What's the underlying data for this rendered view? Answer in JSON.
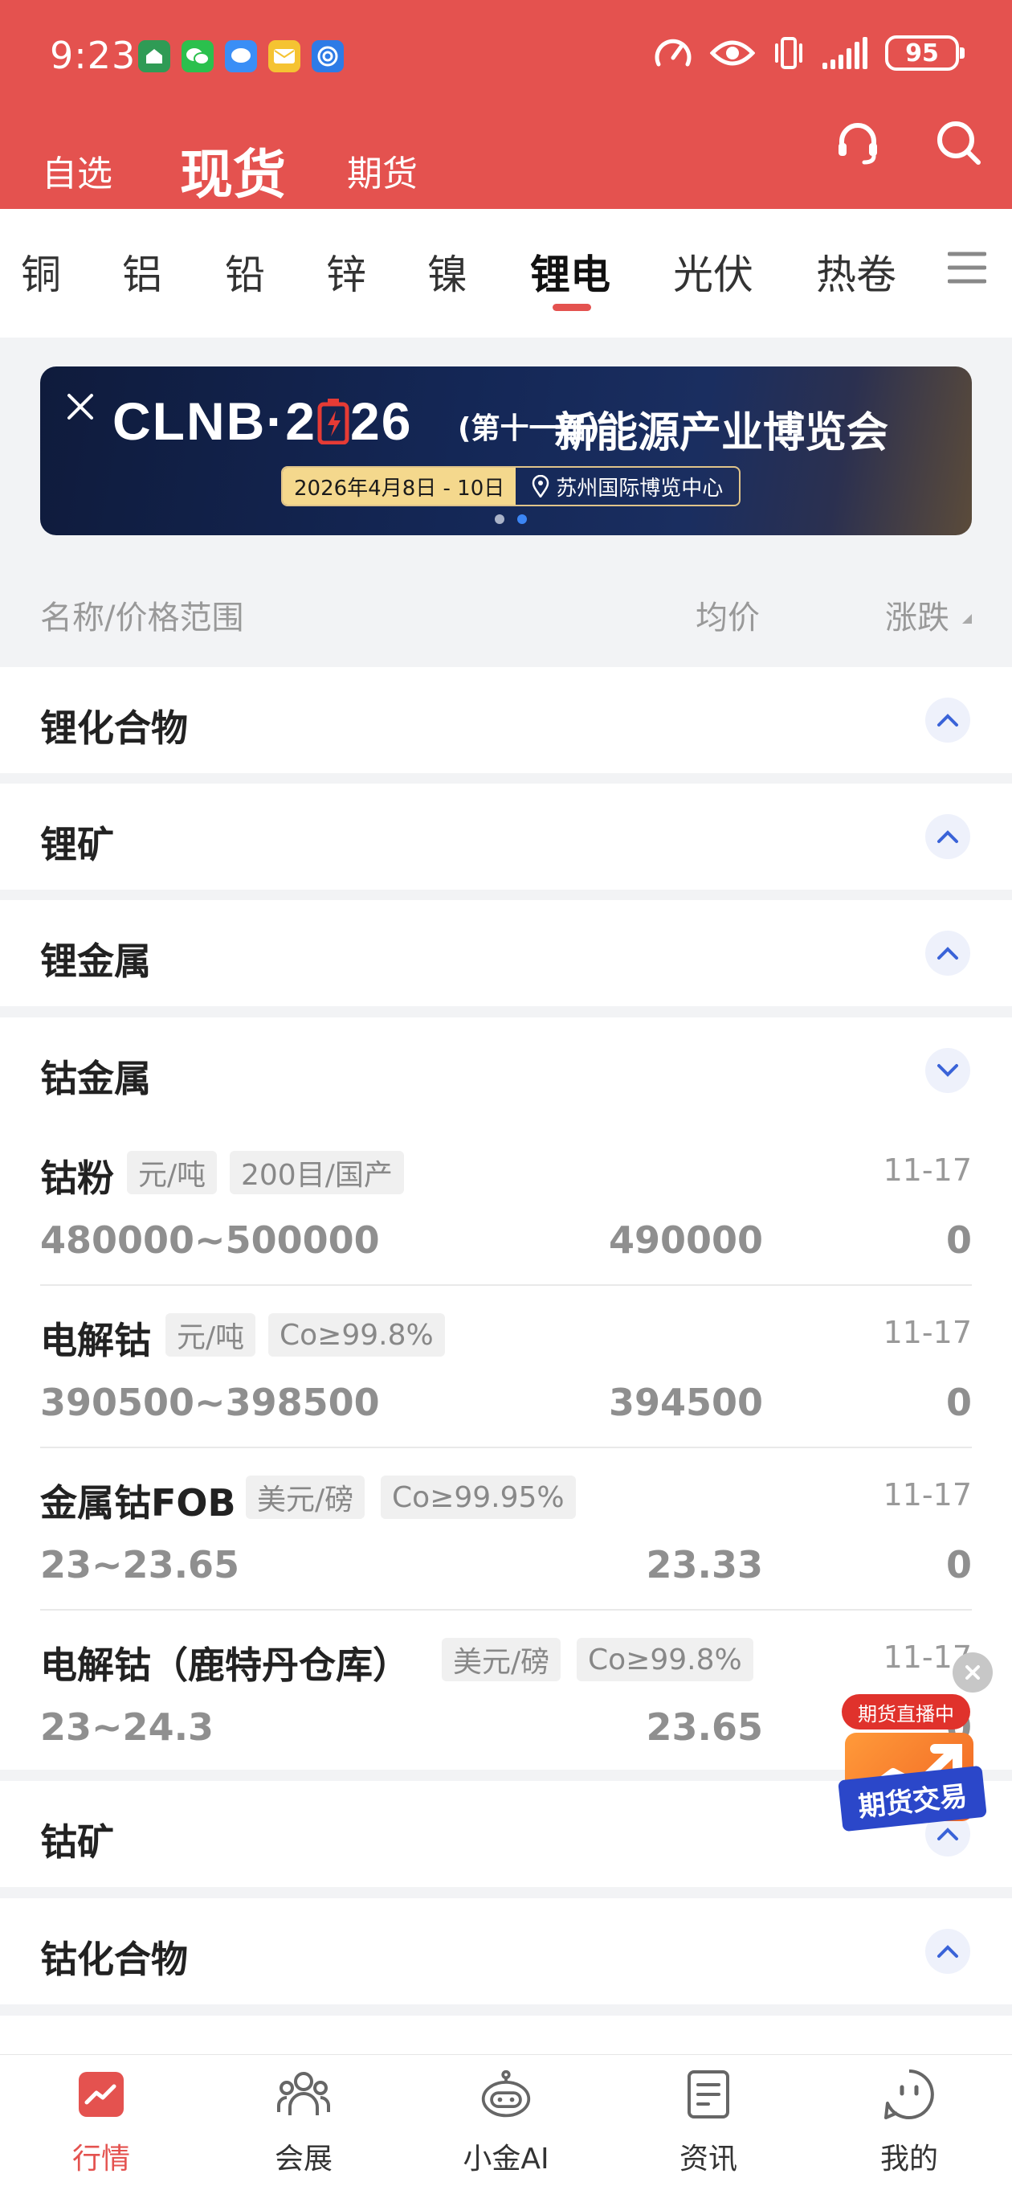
{
  "status_bar": {
    "time": "9:23",
    "battery": "95"
  },
  "header": {
    "tabs": [
      {
        "label": "自选"
      },
      {
        "label": "现货"
      },
      {
        "label": "期货"
      }
    ],
    "active_tab": "现货"
  },
  "categories": [
    {
      "label": "铜"
    },
    {
      "label": "铝"
    },
    {
      "label": "铅"
    },
    {
      "label": "锌"
    },
    {
      "label": "镍"
    },
    {
      "label": "锂电"
    },
    {
      "label": "光伏"
    },
    {
      "label": "热卷"
    }
  ],
  "active_category": "锂电",
  "banner": {
    "title_left": "CLNB·2",
    "title_right": "26",
    "edition": "(第十一届)",
    "subtitle": "新能源产业博览会",
    "date": "2026年4月8日 - 10日",
    "location": "苏州国际博览中心"
  },
  "table_header": {
    "name": "名称/价格范围",
    "avg": "均价",
    "change": "涨跌"
  },
  "groups_top": [
    {
      "title": "锂化合物"
    },
    {
      "title": "锂矿"
    },
    {
      "title": "锂金属"
    }
  ],
  "expanded_group": {
    "title": "钴金属",
    "items": [
      {
        "name": "钴粉",
        "unit": "元/吨",
        "spec": "200目/国产",
        "date": "11-17",
        "range": "480000~500000",
        "avg": "490000",
        "change": "0"
      },
      {
        "name": "电解钴",
        "unit": "元/吨",
        "spec": "Co≥99.8%",
        "date": "11-17",
        "range": "390500~398500",
        "avg": "394500",
        "change": "0"
      },
      {
        "name": "金属钴FOB",
        "unit": "美元/磅",
        "spec": "Co≥99.95%",
        "date": "11-17",
        "range": "23~23.65",
        "avg": "23.33",
        "change": "0"
      },
      {
        "name": "电解钴（鹿特丹仓库）",
        "unit": "美元/磅",
        "spec": "Co≥99.8%",
        "date": "11-17",
        "range": "23~24.3",
        "avg": "23.65",
        "change": "0"
      }
    ]
  },
  "groups_bottom": [
    {
      "title": "钴矿"
    },
    {
      "title": "钴化合物"
    }
  ],
  "float_ad": {
    "live": "期货直播中",
    "label": "期货交易"
  },
  "bottom_nav": [
    {
      "label": "行情"
    },
    {
      "label": "会展"
    },
    {
      "label": "小金AI"
    },
    {
      "label": "资讯"
    },
    {
      "label": "我的"
    }
  ],
  "colors": {
    "brand_red": "#e4524f",
    "chevron_blue": "#3a63d8",
    "banner_navy": "#142756"
  }
}
